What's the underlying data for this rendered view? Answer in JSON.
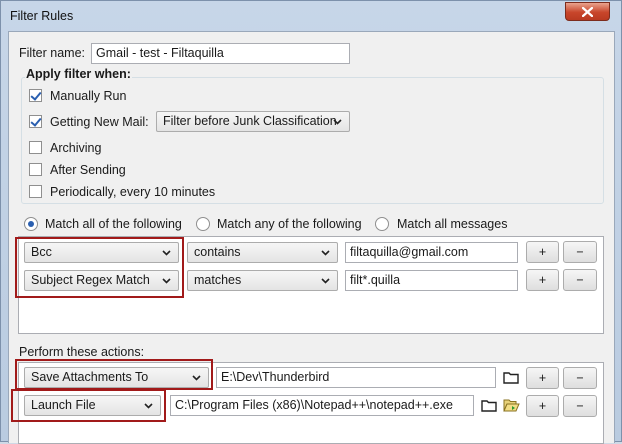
{
  "window": {
    "title": "Filter Rules"
  },
  "filter_name": {
    "label": "Filter name:",
    "value": "Gmail - test - Filtaquilla"
  },
  "apply_when": {
    "heading": "Apply filter when:",
    "options": [
      {
        "label": "Manually Run",
        "checked": true
      },
      {
        "label": "Getting New Mail:",
        "checked": true
      },
      {
        "label": "Archiving",
        "checked": false
      },
      {
        "label": "After Sending",
        "checked": false
      },
      {
        "label": "Periodically, every 10 minutes",
        "checked": false
      }
    ],
    "new_mail_timing": "Filter before Junk Classification"
  },
  "match_mode": {
    "options": [
      "Match all of the following",
      "Match any of the following",
      "Match all messages"
    ],
    "selected": "Match all of the following"
  },
  "rules": [
    {
      "field": "Bcc",
      "operator": "contains",
      "value": "filtaquilla@gmail.com"
    },
    {
      "field": "Subject Regex Match",
      "operator": "matches",
      "value": "filt*.quilla"
    }
  ],
  "actions": {
    "heading": "Perform these actions:",
    "items": [
      {
        "action": "Save Attachments To",
        "target": "E:\\Dev\\Thunderbird"
      },
      {
        "action": "Launch File",
        "target": "C:\\Program Files (x86)\\Notepad++\\notepad++.exe"
      }
    ]
  },
  "buttons": {
    "add": "+",
    "remove": "−"
  },
  "colors": {
    "highlight_outline": "#a11a1a",
    "check_accent": "#2a5fb0"
  }
}
